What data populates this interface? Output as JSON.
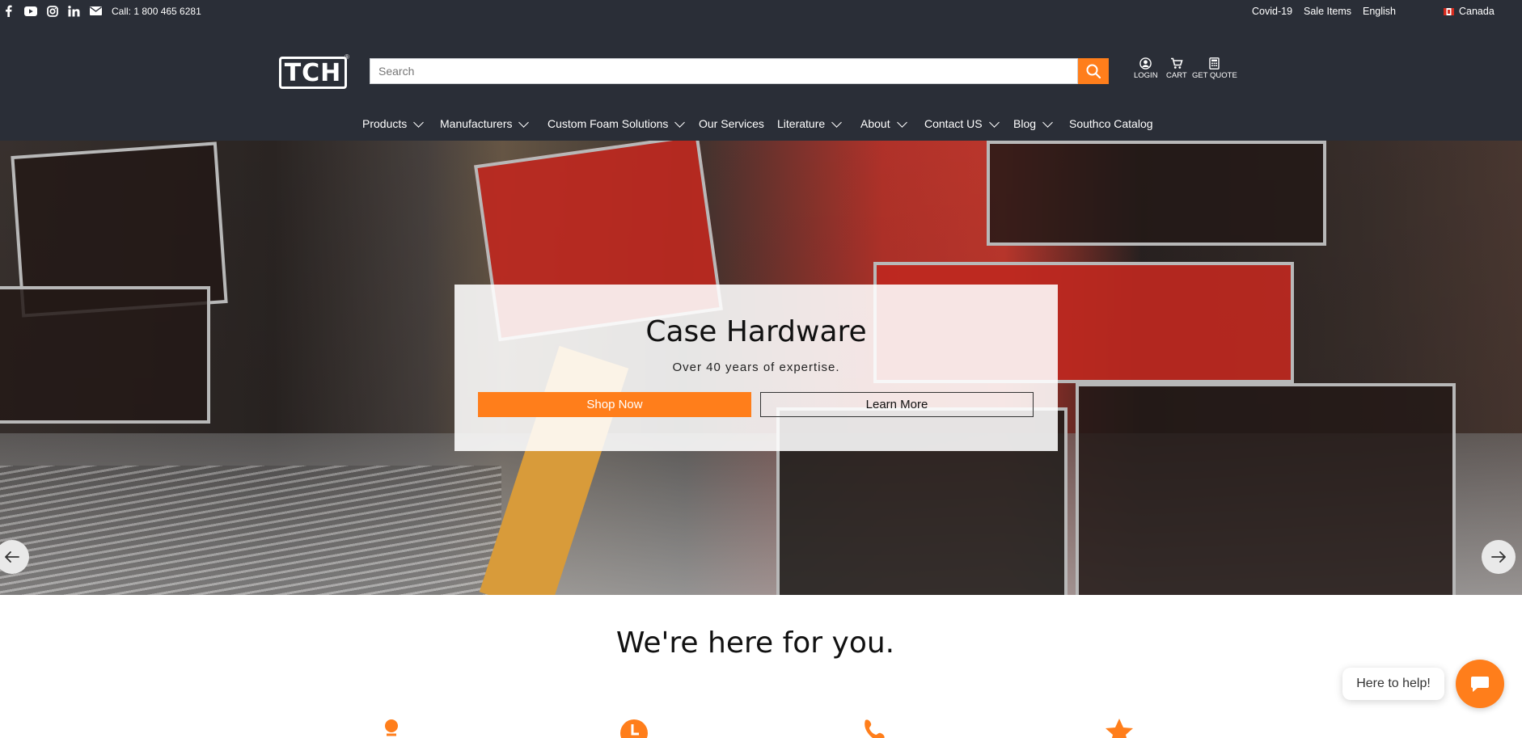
{
  "topbar": {
    "social_icons": [
      "facebook-icon",
      "youtube-icon",
      "instagram-icon",
      "linkedin-icon",
      "email-icon"
    ],
    "call": "Call: 1 800 465 6281",
    "links": {
      "covid": "Covid-19",
      "sale": "Sale Items",
      "language": "English",
      "country": "Canada"
    }
  },
  "header": {
    "logo_text": "TCH",
    "logo_mark": "®",
    "search_placeholder": "Search",
    "icons": {
      "login": "LOGIN",
      "cart": "CART",
      "quote": "GET QUOTE"
    }
  },
  "nav": {
    "items": [
      {
        "label": "Products",
        "dropdown": true
      },
      {
        "label": "Manufacturers",
        "dropdown": true
      },
      {
        "label": "Custom Foam Solutions",
        "dropdown": true
      },
      {
        "label": "Our Services",
        "dropdown": false
      },
      {
        "label": "Literature",
        "dropdown": true
      },
      {
        "label": "About",
        "dropdown": true
      },
      {
        "label": "Contact US",
        "dropdown": true
      },
      {
        "label": "Blog",
        "dropdown": true
      },
      {
        "label": "Southco Catalog",
        "dropdown": false
      }
    ]
  },
  "hero": {
    "title": "Case Hardware",
    "subtitle": "Over 40 years of expertise.",
    "shop_button": "Shop Now",
    "learn_button": "Learn More"
  },
  "section": {
    "title": "We're here for you."
  },
  "chat": {
    "bubble": "Here to help!"
  },
  "colors": {
    "accent": "#ff7e1b",
    "header_bg": "#2a2e37"
  }
}
